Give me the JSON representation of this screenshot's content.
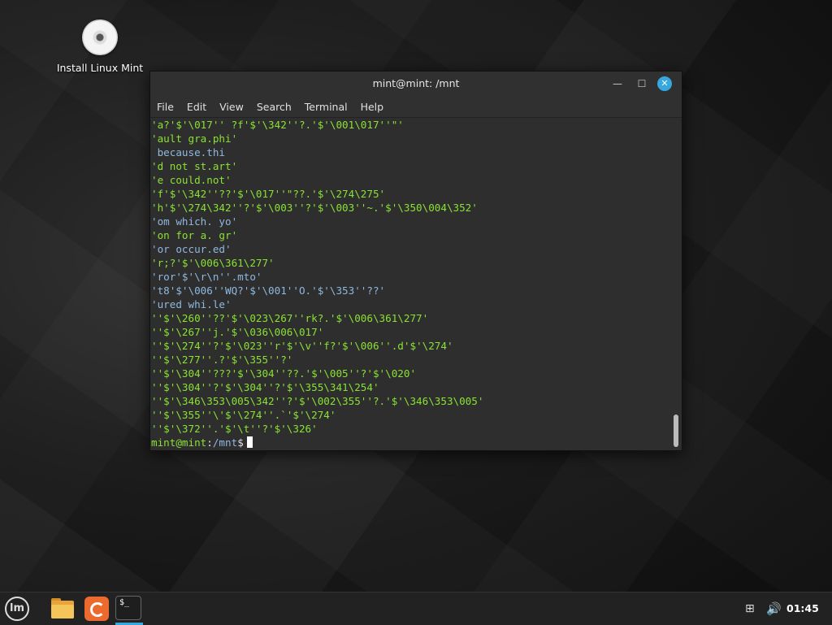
{
  "desktop": {
    "icon_label": "Install Linux Mint",
    "icon": "disc-icon"
  },
  "window": {
    "title": "mint@mint: /mnt",
    "minimize_glyph": "—",
    "maximize_glyph": "☐",
    "close_glyph": "✕",
    "menu": [
      "File",
      "Edit",
      "View",
      "Search",
      "Terminal",
      "Help"
    ]
  },
  "terminal": {
    "lines": [
      {
        "text": "'a?'$'\\017'' ?f'$'\\342''?.'$'\\001\\017''\"'",
        "color": "#8ae234"
      },
      {
        "text": "'ault gra.phi'",
        "color": "#8ae234"
      },
      {
        "text": " because.thi",
        "color": "#90b8e0"
      },
      {
        "text": "'d not st.art'",
        "color": "#8ae234"
      },
      {
        "text": "'e could.not'",
        "color": "#8ae234"
      },
      {
        "text": "'f'$'\\342''??'$'\\017''\"??.'$'\\274\\275'",
        "color": "#8ae234"
      },
      {
        "text": "'h'$'\\274\\342''?'$'\\003''?'$'\\003''~.'$'\\350\\004\\352'",
        "color": "#8ae234"
      },
      {
        "text": "'om which. yo'",
        "color": "#90b8e0"
      },
      {
        "text": "'on for a. gr'",
        "color": "#8ae234"
      },
      {
        "text": "'or occur.ed'",
        "color": "#90b8e0"
      },
      {
        "text": "'r;?'$'\\006\\361\\277'",
        "color": "#8ae234"
      },
      {
        "text": "'ror'$'\\r\\n''.mto'",
        "color": "#90b8e0"
      },
      {
        "text": "'t8'$'\\006''WQ?'$'\\001''O.'$'\\353''??'",
        "color": "#90b8e0"
      },
      {
        "text": "'ured whi.le'",
        "color": "#90b8e0"
      },
      {
        "text": "''$'\\260''??'$'\\023\\267''rk?.'$'\\006\\361\\277'",
        "color": "#8ae234"
      },
      {
        "text": "''$'\\267''j.'$'\\036\\006\\017'",
        "color": "#8ae234"
      },
      {
        "text": "''$'\\274''?'$'\\023''r'$'\\v''f?'$'\\006''.d'$'\\274'",
        "color": "#8ae234"
      },
      {
        "text": "''$'\\277''.?'$'\\355''?'",
        "color": "#8ae234"
      },
      {
        "text": "''$'\\304''???'$'\\304''??.'$'\\005''?'$'\\020'",
        "color": "#8ae234"
      },
      {
        "text": "''$'\\304''?'$'\\304''?'$'\\355\\341\\254'",
        "color": "#8ae234"
      },
      {
        "text": "''$'\\346\\353\\005\\342''?'$'\\002\\355''?.'$'\\346\\353\\005'",
        "color": "#8ae234"
      },
      {
        "text": "''$'\\355''\\'$'\\274''.`'$'\\274'",
        "color": "#8ae234"
      },
      {
        "text": "''$'\\372''.'$'\\t''?'$'\\326'",
        "color": "#8ae234"
      }
    ],
    "prompt_user": "mint@mint",
    "prompt_sep": ":",
    "prompt_path": "/mnt",
    "prompt_end": "$"
  },
  "taskbar": {
    "menu_glyph": "lm",
    "terminal_glyph": "$_",
    "network_glyph": "⊞",
    "volume_glyph": "🔊",
    "clock": "01:45"
  }
}
